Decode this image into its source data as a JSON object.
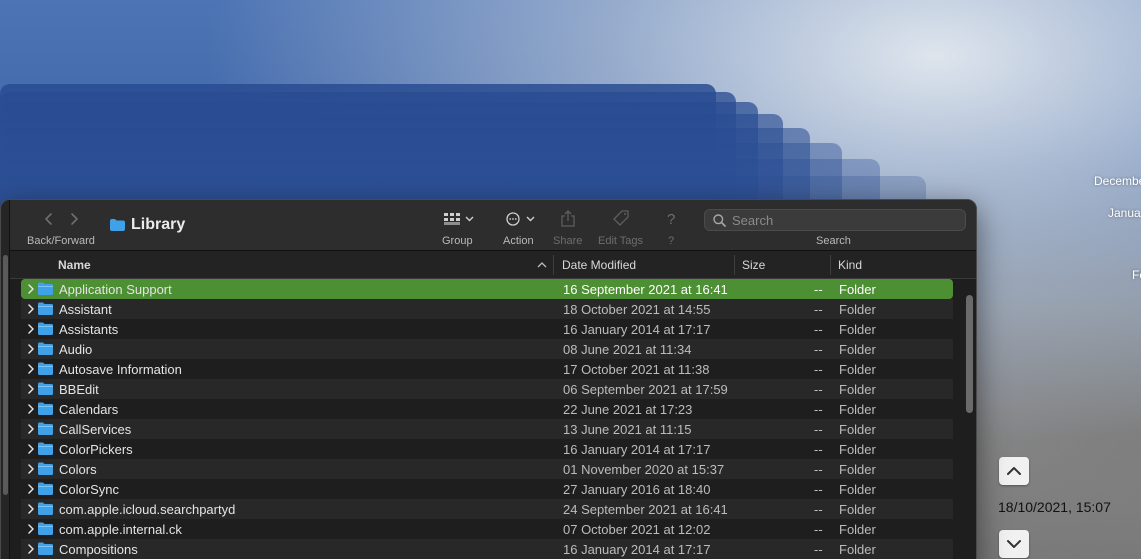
{
  "background": {
    "timeline_labels": [
      "December",
      "Janua",
      "Fe"
    ],
    "timestamp": "18/10/2021, 15:07"
  },
  "toolbar": {
    "back_forward_label": "Back/Forward",
    "title": "Library",
    "group_label": "Group",
    "action_label": "Action",
    "share_label": "Share",
    "edit_tags_label": "Edit Tags",
    "help_label": "?",
    "search_label": "Search",
    "search_placeholder": "Search"
  },
  "columns": {
    "name": "Name",
    "date_modified": "Date Modified",
    "size": "Size",
    "kind": "Kind"
  },
  "files": [
    {
      "name": "Application Support",
      "date": "16 September 2021 at 16:41",
      "size": "--",
      "kind": "Folder",
      "selected": true
    },
    {
      "name": "Assistant",
      "date": "18 October 2021 at 14:55",
      "size": "--",
      "kind": "Folder"
    },
    {
      "name": "Assistants",
      "date": "16 January 2014 at 17:17",
      "size": "--",
      "kind": "Folder"
    },
    {
      "name": "Audio",
      "date": "08 June 2021 at 11:34",
      "size": "--",
      "kind": "Folder"
    },
    {
      "name": "Autosave Information",
      "date": "17 October 2021 at 11:38",
      "size": "--",
      "kind": "Folder"
    },
    {
      "name": "BBEdit",
      "date": "06 September 2021 at 17:59",
      "size": "--",
      "kind": "Folder"
    },
    {
      "name": "Calendars",
      "date": "22 June 2021 at 17:23",
      "size": "--",
      "kind": "Folder"
    },
    {
      "name": "CallServices",
      "date": "13 June 2021 at 11:15",
      "size": "--",
      "kind": "Folder"
    },
    {
      "name": "ColorPickers",
      "date": "16 January 2014 at 17:17",
      "size": "--",
      "kind": "Folder"
    },
    {
      "name": "Colors",
      "date": "01 November 2020 at 15:37",
      "size": "--",
      "kind": "Folder"
    },
    {
      "name": "ColorSync",
      "date": "27 January 2016 at 18:40",
      "size": "--",
      "kind": "Folder"
    },
    {
      "name": "com.apple.icloud.searchpartyd",
      "date": "24 September 2021 at 16:41",
      "size": "--",
      "kind": "Folder"
    },
    {
      "name": "com.apple.internal.ck",
      "date": "07 October 2021 at 12:02",
      "size": "--",
      "kind": "Folder"
    },
    {
      "name": "Compositions",
      "date": "16 January 2014 at 17:17",
      "size": "--",
      "kind": "Folder"
    }
  ],
  "colors": {
    "selection": "#4d8f33",
    "folder": "#3fa2e8"
  }
}
